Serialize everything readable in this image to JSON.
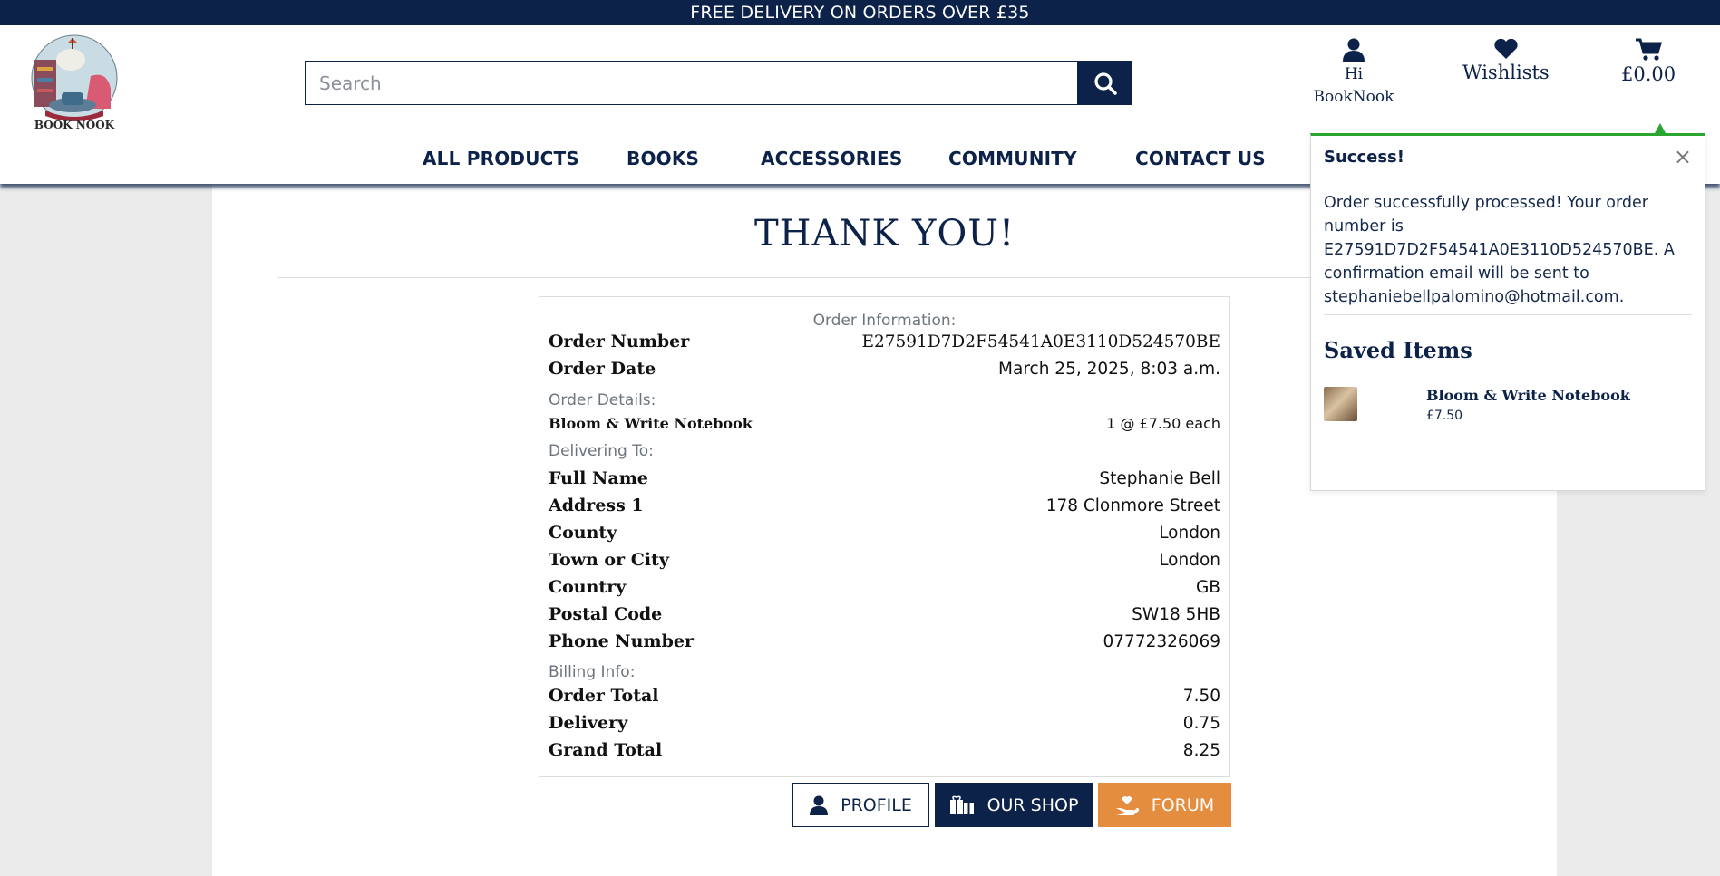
{
  "banner": {
    "text": "FREE DELIVERY ON ORDERS OVER £35"
  },
  "brand": {
    "logo_text": "BOOK NOOK"
  },
  "search": {
    "placeholder": "Search"
  },
  "header": {
    "account_line1": "Hi",
    "account_line2": "BookNook",
    "wishlists": "Wishlists",
    "cart_total": "£0.00"
  },
  "nav": {
    "items": [
      "ALL PRODUCTS",
      "BOOKS",
      "ACCESSORIES",
      "COMMUNITY",
      "CONTACT US"
    ]
  },
  "page": {
    "title": "THANK YOU!"
  },
  "order": {
    "info_heading": "Order Information:",
    "order_number_label": "Order Number",
    "order_number": "E27591D7D2F54541A0E3110D524570BE",
    "order_date_label": "Order Date",
    "order_date": "March 25, 2025, 8:03 a.m.",
    "details_heading": "Order Details:",
    "item_name": "Bloom & Write Notebook",
    "item_qty": "1 @ £7.50 each",
    "delivering_heading": "Delivering To:",
    "delivery": [
      {
        "label": "Full Name",
        "value": "Stephanie Bell"
      },
      {
        "label": "Address 1",
        "value": "178 Clonmore Street"
      },
      {
        "label": "County",
        "value": "London"
      },
      {
        "label": "Town or City",
        "value": "London"
      },
      {
        "label": "Country",
        "value": "GB"
      },
      {
        "label": "Postal Code",
        "value": "SW18 5HB"
      },
      {
        "label": "Phone Number",
        "value": "07772326069"
      }
    ],
    "billing_heading": "Billing Info:",
    "billing": [
      {
        "label": "Order Total",
        "value": "7.50"
      },
      {
        "label": "Delivery",
        "value": "0.75"
      },
      {
        "label": "Grand Total",
        "value": "8.25"
      }
    ]
  },
  "buttons": {
    "profile": "PROFILE",
    "shop": "OUR SHOP",
    "forum": "FORUM"
  },
  "toast": {
    "title": "Success!",
    "close": "×",
    "message": "Order successfully processed! Your order number is E27591D7D2F54541A0E3110D524570BE. A confirmation email will be sent to stephaniebellpalomino@hotmail.com.",
    "saved_heading": "Saved Items",
    "item_name": "Bloom & Write Notebook",
    "item_price": "£7.50"
  },
  "colors": {
    "navy": "#0c2248",
    "orange": "#e48d3f",
    "success": "#2aa52f",
    "page_bg": "#ebebeb"
  }
}
